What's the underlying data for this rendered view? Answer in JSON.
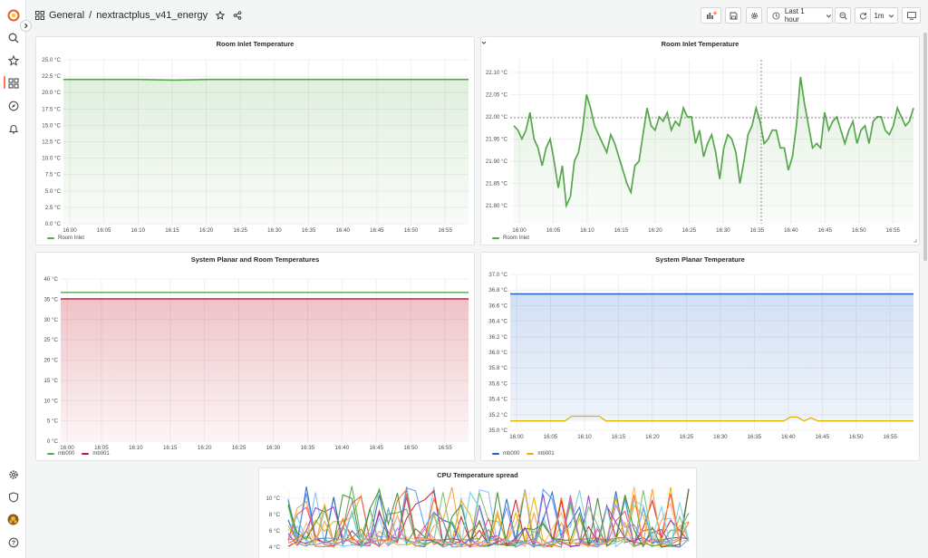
{
  "colors": {
    "accent": "#ff7941",
    "green": "#56a64b",
    "red": "#c4162a",
    "blue": "#1f60c4",
    "yellow": "#e0b400"
  },
  "sidebar": {
    "icons": [
      "grafana-logo-icon",
      "search-icon",
      "star-icon",
      "dashboards-icon",
      "explore-icon",
      "alerting-icon"
    ],
    "bottom_icons": [
      "gear-icon",
      "shield-icon",
      "avatar",
      "help-icon"
    ]
  },
  "header": {
    "folder": "General",
    "separator": "/",
    "dashboard_title": "nextractplus_v41_energy",
    "time_range": "Last 1 hour",
    "refresh_interval": "1m"
  },
  "panels": {
    "p1": {
      "title": "Room Inlet Temperature",
      "yticks": [
        "25.0 °C",
        "22.5 °C",
        "20.0 °C",
        "17.5 °C",
        "15.0 °C",
        "12.5 °C",
        "10.0 °C",
        "7.5 °C",
        "5.0 °C",
        "2.5 °C",
        "0.0 °C"
      ],
      "xticks": [
        "16:00",
        "16:05",
        "16:10",
        "16:15",
        "16:20",
        "16:25",
        "16:30",
        "16:35",
        "16:40",
        "16:45",
        "16:50",
        "16:55"
      ],
      "legend": [
        "Room Inlet"
      ]
    },
    "p2": {
      "title": "Room Inlet Temperature",
      "yticks": [
        "22.10 °C",
        "22.05 °C",
        "22.00 °C",
        "21.95 °C",
        "21.90 °C",
        "21.85 °C",
        "21.80 °C"
      ],
      "xticks": [
        "16:00",
        "16:05",
        "16:10",
        "16:15",
        "16:20",
        "16:25",
        "16:30",
        "16:35",
        "16:40",
        "16:45",
        "16:50",
        "16:55"
      ],
      "legend": [
        "Room Inlet"
      ]
    },
    "p3": {
      "title": "System Planar and Room Temperatures",
      "yticks": [
        "40 °C",
        "35 °C",
        "30 °C",
        "25 °C",
        "20 °C",
        "15 °C",
        "10 °C",
        "5 °C",
        "0 °C"
      ],
      "xticks": [
        "16:00",
        "16:05",
        "16:10",
        "16:15",
        "16:20",
        "16:25",
        "16:30",
        "16:35",
        "16:40",
        "16:45",
        "16:50",
        "16:55"
      ],
      "legend": [
        "mb000",
        "mb001"
      ]
    },
    "p4": {
      "title": "System Planar Temperature",
      "yticks": [
        "37.0 °C",
        "36.8 °C",
        "36.6 °C",
        "36.4 °C",
        "36.2 °C",
        "36.0 °C",
        "35.8 °C",
        "35.6 °C",
        "35.4 °C",
        "35.2 °C",
        "35.0 °C"
      ],
      "xticks": [
        "16:00",
        "16:05",
        "16:10",
        "16:15",
        "16:20",
        "16:25",
        "16:30",
        "16:35",
        "16:40",
        "16:45",
        "16:50",
        "16:55"
      ],
      "legend": [
        "mb000",
        "mb001"
      ]
    },
    "p5": {
      "title": "CPU Temperature spread",
      "yticks": [
        "10 °C",
        "8 °C",
        "6 °C",
        "4 °C"
      ]
    }
  },
  "chart_data": [
    {
      "type": "line",
      "title": "Room Inlet Temperature",
      "ylim": [
        0,
        25
      ],
      "x": [
        "16:00",
        "16:05",
        "16:10",
        "16:15",
        "16:20",
        "16:25",
        "16:30",
        "16:35",
        "16:40",
        "16:45",
        "16:50",
        "16:55"
      ],
      "series": [
        {
          "name": "Room Inlet",
          "values": [
            22.0,
            22.0,
            22.0,
            21.9,
            22.0,
            22.0,
            22.0,
            22.0,
            22.0,
            22.0,
            22.0,
            22.0
          ]
        }
      ]
    },
    {
      "type": "line",
      "title": "Room Inlet Temperature",
      "ylim": [
        21.77,
        22.12
      ],
      "series": [
        {
          "name": "Room Inlet",
          "values": [
            21.98,
            21.97,
            21.95,
            21.97,
            22.01,
            21.95,
            21.93,
            21.89,
            21.93,
            21.95,
            21.9,
            21.84,
            21.89,
            21.8,
            21.82,
            21.9,
            21.92,
            21.97,
            22.05,
            22.02,
            21.98,
            21.96,
            21.94,
            21.92,
            21.96,
            21.94,
            21.91,
            21.88,
            21.85,
            21.83,
            21.89,
            21.9,
            21.96,
            22.02,
            21.98,
            21.97,
            22.0,
            21.99,
            22.01,
            21.97,
            21.99,
            21.98,
            22.02,
            22.0,
            22.0,
            21.94,
            21.97,
            21.91,
            21.94,
            21.96,
            21.92,
            21.86,
            21.93,
            21.96,
            21.95,
            21.92,
            21.85,
            21.9,
            21.96,
            21.98,
            22.02,
            21.99,
            21.94,
            21.95,
            21.97,
            21.97,
            21.93,
            21.93,
            21.88,
            21.91,
            21.98,
            22.09,
            22.03,
            21.98,
            21.93,
            21.94,
            21.93,
            22.01,
            21.97,
            21.99,
            22.0,
            21.97,
            21.94,
            21.97,
            21.99,
            21.94,
            21.97,
            21.98,
            21.94,
            21.99,
            22.0,
            22.0,
            21.97,
            21.96,
            21.98,
            22.02,
            22.0,
            21.98,
            21.99,
            22.02
          ]
        }
      ]
    },
    {
      "type": "area",
      "title": "System Planar and Room Temperatures",
      "ylim": [
        0,
        40
      ],
      "series": [
        {
          "name": "mb000",
          "values": [
            36.7,
            36.7,
            36.7,
            36.7,
            36.7,
            36.7,
            36.7,
            36.7,
            36.7,
            36.7,
            36.7,
            36.7
          ]
        },
        {
          "name": "mb001",
          "values": [
            35.1,
            35.1,
            35.1,
            35.1,
            35.1,
            35.1,
            35.1,
            35.1,
            35.1,
            35.1,
            35.1,
            35.1
          ]
        }
      ]
    },
    {
      "type": "area",
      "title": "System Planar Temperature",
      "ylim": [
        35.0,
        37.0
      ],
      "series": [
        {
          "name": "mb000",
          "values": [
            36.75,
            36.75,
            36.75,
            36.75,
            36.75,
            36.75,
            36.75,
            36.75,
            36.75,
            36.75,
            36.75,
            36.75
          ]
        },
        {
          "name": "mb001",
          "values": [
            35.12,
            35.12,
            35.12,
            35.12,
            35.12,
            35.12,
            35.12,
            35.12,
            35.12,
            35.12,
            35.12,
            35.12,
            35.12,
            35.12,
            35.12,
            35.12,
            35.12,
            35.12,
            35.12,
            35.12,
            35.12,
            35.12,
            35.12,
            35.12,
            35.12,
            35.12,
            35.12,
            35.12,
            35.12,
            35.12,
            35.12,
            35.12,
            35.12,
            35.12,
            35.12,
            35.12,
            35.12,
            35.12,
            35.12,
            35.12,
            35.12,
            35.12,
            35.12,
            35.12,
            35.12,
            35.12,
            35.12,
            35.12,
            35.12,
            35.12,
            35.12,
            35.12,
            35.12,
            35.12,
            35.12,
            35.12,
            35.12,
            35.12,
            35.12,
            35.12
          ]
        }
      ]
    }
  ]
}
